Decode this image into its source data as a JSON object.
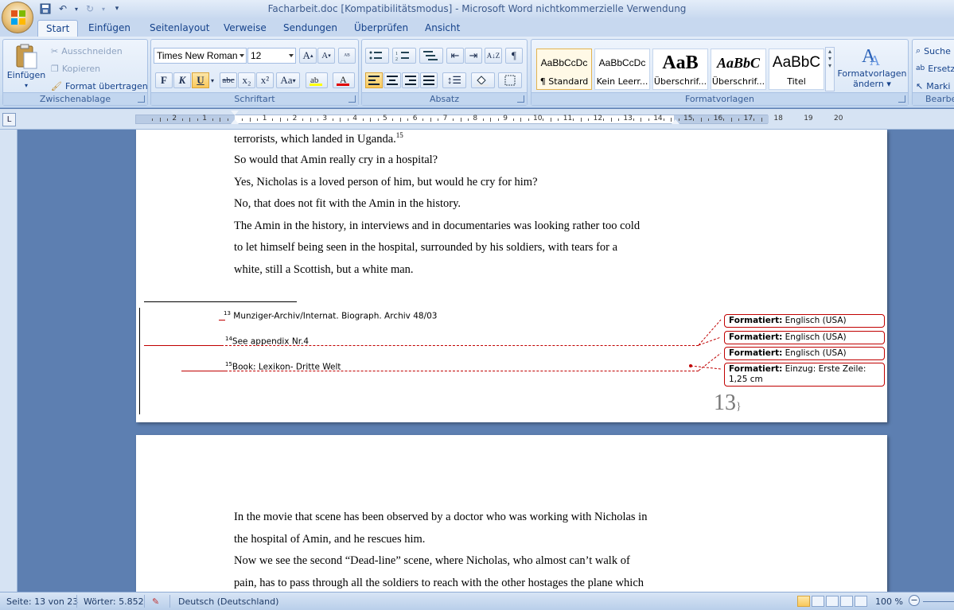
{
  "window": {
    "title": "Facharbeit.doc [Kompatibilitätsmodus] - Microsoft Word nichtkommerzielle Verwendung"
  },
  "tabs": [
    {
      "label": "Start",
      "active": true
    },
    {
      "label": "Einfügen"
    },
    {
      "label": "Seitenlayout"
    },
    {
      "label": "Verweise"
    },
    {
      "label": "Sendungen"
    },
    {
      "label": "Überprüfen"
    },
    {
      "label": "Ansicht"
    }
  ],
  "clipboard": {
    "paste": "Einfügen",
    "cut": "Ausschneiden",
    "copy": "Kopieren",
    "format_painter": "Format übertragen",
    "label": "Zwischenablage"
  },
  "font": {
    "family": "Times New Roman",
    "size": "12",
    "label": "Schriftart",
    "bold": "F",
    "italic": "K",
    "underline": "U",
    "strike": "abc",
    "sub": "x₂",
    "sup": "x²",
    "case": "Aa",
    "grow": "A",
    "shrink": "A"
  },
  "paragraph": {
    "label": "Absatz"
  },
  "styles": {
    "label": "Formatvorlagen",
    "items": [
      {
        "sample": "AaBbCcDc",
        "name": "¶ Standard"
      },
      {
        "sample": "AaBbCcDc",
        "name": "Kein Leerr..."
      },
      {
        "sample": "AaB",
        "name": "Überschrif..."
      },
      {
        "sample": "AaBbC",
        "name": "Überschrif..."
      },
      {
        "sample": "AaBbC",
        "name": "Titel"
      }
    ],
    "change_line1": "Formatvorlagen",
    "change_line2": "ändern"
  },
  "editing": {
    "search": "Suche",
    "replace": "Ersetz",
    "select": "Marki",
    "label": "Bearbe"
  },
  "ruler": {
    "left_numbers": [
      "2",
      "1"
    ],
    "right_numbers": [
      "1",
      "2",
      "3",
      "4",
      "5",
      "6",
      "7",
      "8",
      "9",
      "10",
      "11",
      "12",
      "13",
      "14",
      "15",
      "16",
      "17",
      "18",
      "19",
      "20"
    ]
  },
  "page1": {
    "lines": [
      "terrorists, which landed in Uganda.",
      "So would that Amin really  cry in a hospital?",
      "Yes, Nicholas is a loved person of him, but would he cry for him?",
      "No, that does not fit with the Amin in the history.",
      "The Amin in the history, in interviews and in  documentaries was looking rather too cold",
      "to let himself being  seen in the hospital, surrounded by his soldiers, with tears for a",
      "white, still a Scottish, but a white man."
    ],
    "first_line_sup": "15",
    "footnotes": [
      {
        "num": "13",
        "text": "Munziger-Archiv/Internat. Biograph. Archiv 48/03"
      },
      {
        "num": "14",
        "text": "See appendix Nr.4"
      },
      {
        "num": "15",
        "text": "Book: Lexikon- Dritte Welt"
      }
    ],
    "page_number": "13",
    "page_brace": "}"
  },
  "balloons": [
    {
      "label": "Formatiert:",
      "text": " Englisch (USA)"
    },
    {
      "label": "Formatiert:",
      "text": " Englisch (USA)"
    },
    {
      "label": "Formatiert:",
      "text": " Englisch (USA)"
    },
    {
      "label": "Formatiert:",
      "text": " Einzug: Erste Zeile:   1,25 cm"
    }
  ],
  "page2": {
    "lines": [
      "In the movie that scene has been observed by a doctor who was working with Nicholas in",
      "the hospital of Amin, and he rescues him.",
      "Now we see the second “Dead-line” scene, where Nicholas, who almost can’t walk of",
      "pain, has to pass through all the soldiers to reach with the other hostages the plane which"
    ]
  },
  "status": {
    "page": "Seite: 13 von 23",
    "words": "Wörter: 5.852",
    "language": "Deutsch (Deutschland)",
    "zoom": "100 %"
  },
  "colors": {
    "revision": "#c00000",
    "ribbon": "#dbe7f6",
    "workspace": "#5d7fb1"
  }
}
